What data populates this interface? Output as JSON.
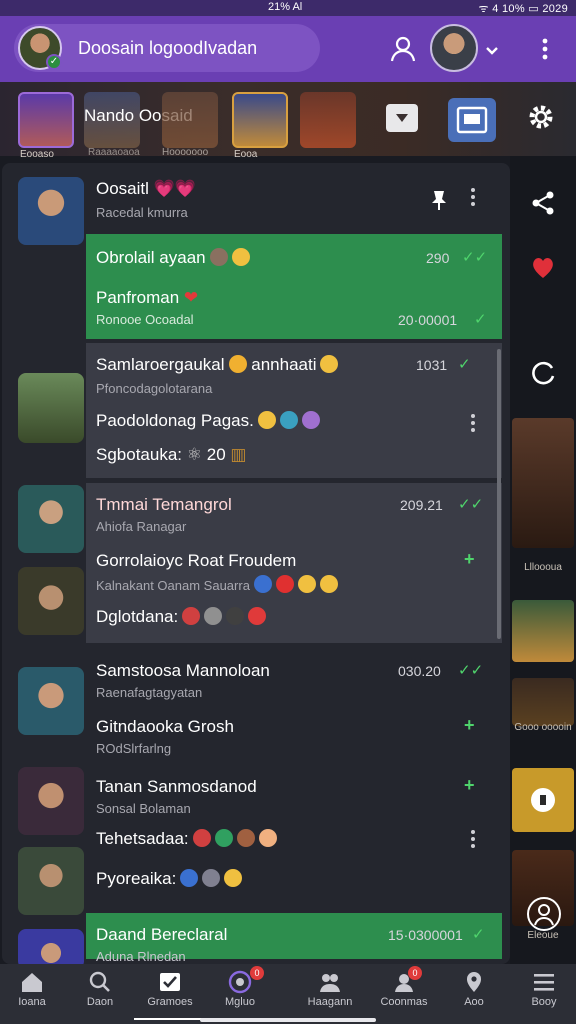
{
  "status_bar": {
    "left": "21% Al",
    "right": "ᯤ 4 10% ▭ 2029"
  },
  "top_bar": {
    "search_text": "Doosain logoodIvadan"
  },
  "stories": {
    "items": [
      {
        "label": "Eooaso"
      },
      {
        "label": "Raaaaoaoa"
      },
      {
        "label": "Hooooooo"
      },
      {
        "label": "Eooa"
      }
    ],
    "highlight_name": "Nando Oosaid"
  },
  "chats": [
    {
      "title": "Oosaitl",
      "subtitle": "Racedal kmurra",
      "message": "Obrolail ayaan",
      "time": "290",
      "message2": "Panfroman",
      "subtitle2": "Ronooe Ocoadal",
      "time2": "20·00001"
    },
    {
      "title": "Samlaroergaukal",
      "title2": "annhaati",
      "time": "1031",
      "subtitle": "Pfoncodagolotarana",
      "message": "Paodoldonag Pagas.",
      "message2": "Sgbotauka:",
      "message2_value": "20"
    },
    {
      "title": "Tmmai Temangrol",
      "time": "209.21",
      "subtitle": "Ahiofa Ranagar",
      "message": "Gorrolaioyc Roat Froudem",
      "subtitle2": "Kalnakant Oanam Sauarra",
      "message2": "Dglotdana:"
    },
    {
      "title": "Samstoosa Mannoloan",
      "time": "030.20",
      "subtitle": "Raenafagtagyatan",
      "message": "Gitndaooka Grosh",
      "subtitle2": "ROdSlrfarlng"
    },
    {
      "title": "Tanan Sanmosdanod",
      "subtitle": "Sonsal Bolaman",
      "message": "Tehetsadaa:",
      "message2": "Pyoreaika:"
    },
    {
      "title": "Daand Bereclaral",
      "time": "15·0300001",
      "subtitle": "Aduna Rlnedan"
    }
  ],
  "rail": {
    "items": [
      {
        "label": "Llloooua"
      },
      {
        "label": "Gooo ooooin"
      },
      {
        "label": "Eleoue"
      }
    ]
  },
  "bottom_nav": {
    "items": [
      {
        "label": "Ioana"
      },
      {
        "label": "Daon"
      },
      {
        "label": "Gramoes"
      },
      {
        "label": "Mgluo",
        "badge": "0"
      },
      {
        "label": "Haagann"
      },
      {
        "label": "Coonmas",
        "badge": "0"
      },
      {
        "label": "Aoo"
      },
      {
        "label": "Booy"
      }
    ]
  },
  "colors": {
    "top_bar": "#6a3fb3",
    "accent_green": "#2d8e4e",
    "check_green": "#4fd46c",
    "panel_bg": "#24262e",
    "badge_red": "#e03b3b"
  }
}
